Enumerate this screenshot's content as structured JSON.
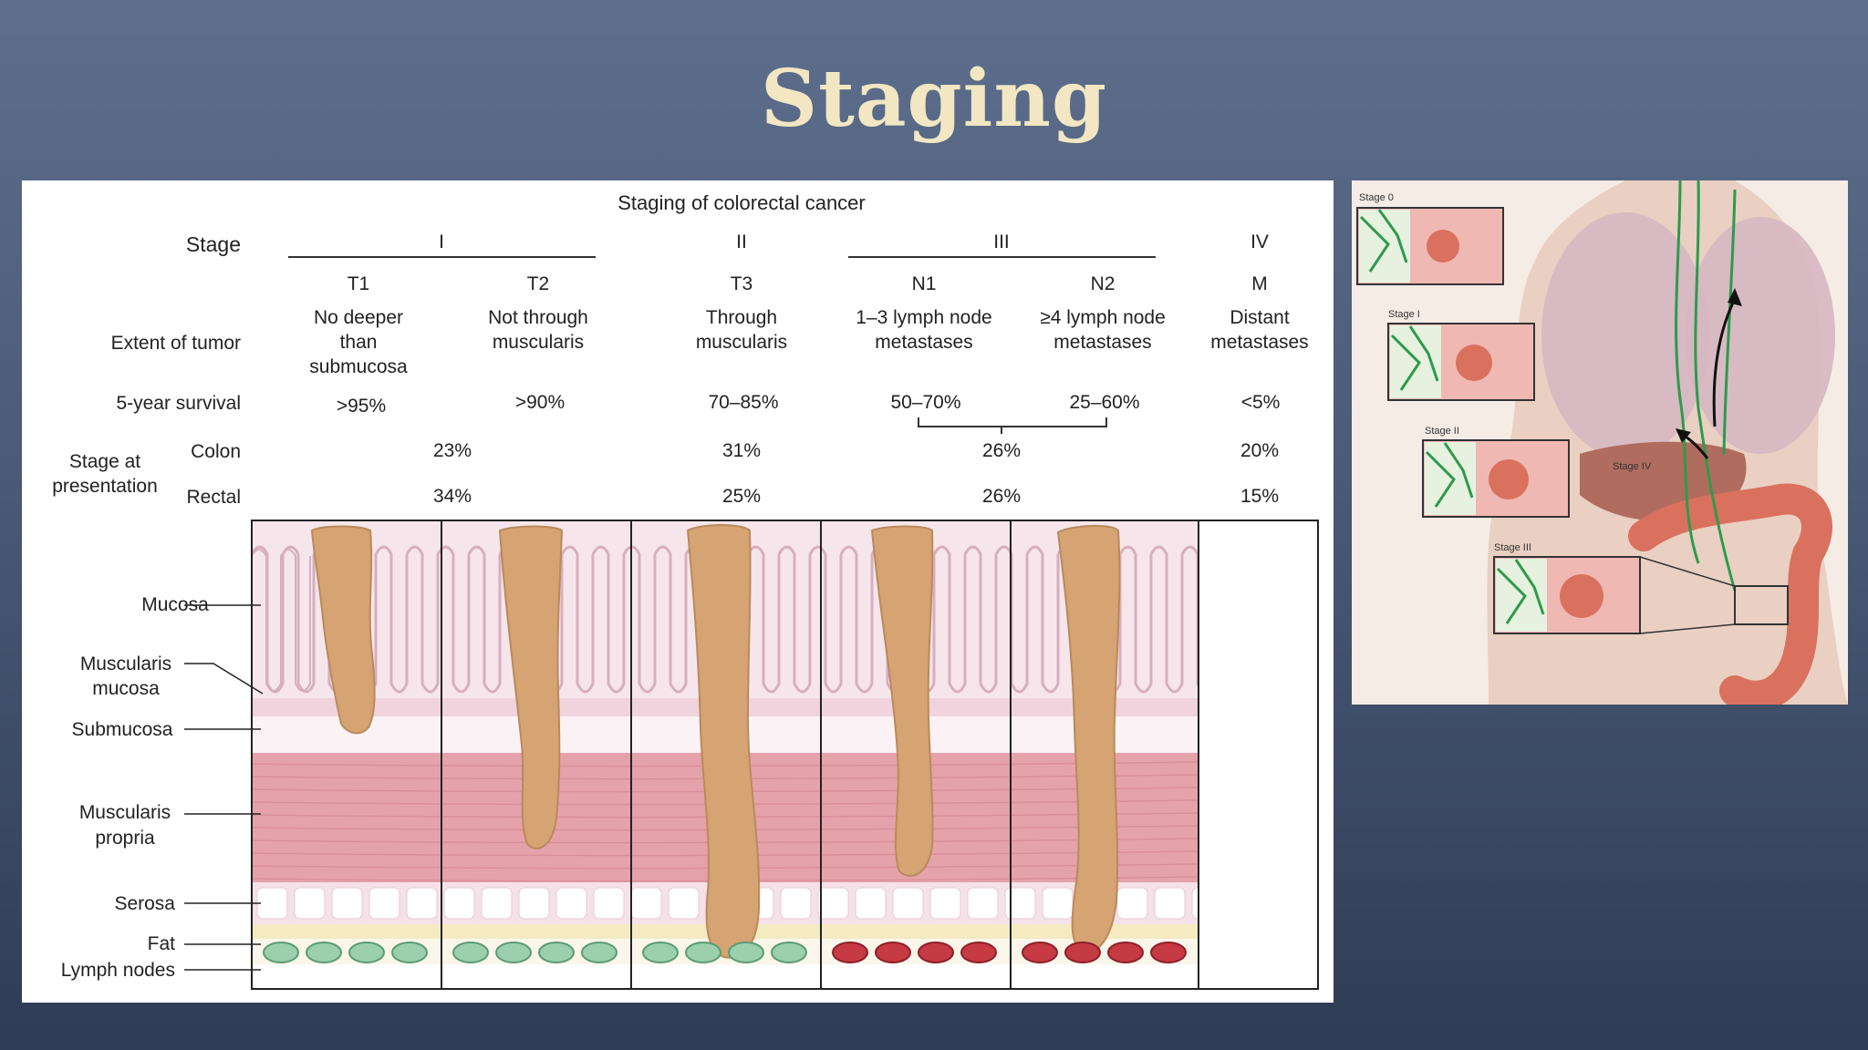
{
  "slide": {
    "title": "Staging"
  },
  "figure": {
    "title": "Staging of colorectal cancer",
    "row_labels": {
      "stage": "Stage",
      "extent": "Extent of tumor",
      "survival": "5-year survival",
      "presentation": [
        "Stage at",
        "presentation"
      ],
      "colon": "Colon",
      "rectal": "Rectal"
    },
    "stage_groups": [
      "I",
      "II",
      "III",
      "IV"
    ],
    "columns": [
      {
        "code": "T1",
        "extent": [
          "No deeper",
          "than",
          "submucosa"
        ],
        "survival": ">95%"
      },
      {
        "code": "T2",
        "extent": [
          "Not through",
          "muscularis"
        ],
        "survival": ">90%"
      },
      {
        "code": "T3",
        "extent": [
          "Through",
          "muscularis"
        ],
        "survival": "70–85%"
      },
      {
        "code": "N1",
        "extent": [
          "1–3 lymph node",
          "metastases"
        ],
        "survival": "50–70%"
      },
      {
        "code": "N2",
        "extent": [
          "≥4 lymph node",
          "metastases"
        ],
        "survival": "25–60%"
      },
      {
        "code": "M",
        "extent": [
          "Distant",
          "metastases"
        ],
        "survival": "<5%"
      }
    ],
    "presentation": {
      "colon": [
        "23%",
        "31%",
        "26%",
        "20%"
      ],
      "rectal": [
        "34%",
        "25%",
        "26%",
        "15%"
      ]
    },
    "layer_labels": [
      [
        "Mucosa"
      ],
      [
        "Muscularis",
        "mucosa"
      ],
      [
        "Submucosa"
      ],
      [
        "Muscularis",
        "propria"
      ],
      [
        "Serosa"
      ],
      [
        "Fat"
      ],
      [
        "Lymph nodes"
      ]
    ],
    "colors": {
      "tumor": "#d6a373",
      "muscle": "#e6a2aa",
      "mucosa_bg": "#f6e6ec",
      "healthy_node": "#9ccfae",
      "metastatic_node": "#c63a44",
      "fat": "#f4ebc2"
    }
  },
  "anatomy": {
    "stage_labels": [
      "Stage 0",
      "Stage I",
      "Stage II",
      "Stage III",
      "Stage IV"
    ],
    "colors": {
      "skin": "#e9d0c2",
      "lymph": "#2e9a4c",
      "colon": "#d9715e",
      "lung": "#d6b7c2",
      "liver": "#b06c5e"
    }
  }
}
